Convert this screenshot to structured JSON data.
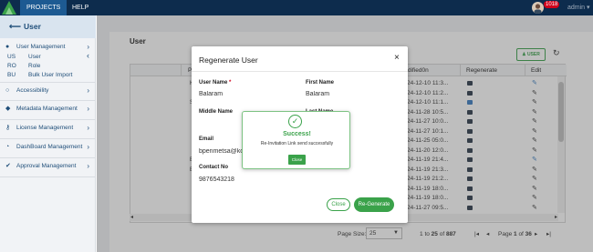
{
  "topbar": {
    "nav": [
      "PROJECTS",
      "HELP"
    ],
    "badge": "1018",
    "user": "admin",
    "caret": "▾"
  },
  "sidebar": {
    "header": "User",
    "user_management": "User Management",
    "sub_items": [
      {
        "code": "US",
        "label": "User"
      },
      {
        "code": "RO",
        "label": "Role"
      },
      {
        "code": "BU",
        "label": "Bulk User Import"
      }
    ],
    "sections": [
      "Accessibility",
      "Metadata Management",
      "License Management",
      "DashBoard Management",
      "Approval Management"
    ]
  },
  "page": {
    "title": "User",
    "add_user_button": "USER",
    "refresh_icon": "↻"
  },
  "grid": {
    "headers": {
      "p": "P",
      "modified": "dified0n",
      "regenerate": "Regenerate",
      "edit": "Edit"
    },
    "left_letters": [
      "K",
      "",
      "S",
      "",
      "",
      "",
      "",
      "",
      "E",
      "E",
      "",
      "",
      "",
      ""
    ],
    "modified_on": [
      "24-12-10 11:3...",
      "24-12-10 11:2...",
      "24-12-10 11:1...",
      "24-11-28 10:5...",
      "24-11-27 10:0...",
      "24-11-27 10:1...",
      "24-11-25 05:0...",
      "24-11-20 12:0...",
      "24-11-19 21:4...",
      "24-11-19 21:3...",
      "24-11-19 21:2...",
      "24-11-19 18:0...",
      "24-11-19 18:0...",
      "24-11-27 09:5..."
    ],
    "blue_regen_rows": [
      2
    ],
    "blue_edit_rows": [
      0,
      8
    ]
  },
  "pager": {
    "page_size_label": "Page Size:",
    "page_size": "25",
    "range_from": "1",
    "to_word": "to",
    "range_to": "25",
    "of_word": "of",
    "total": "887",
    "page_word": "Page",
    "current_page": "1",
    "total_pages": "36"
  },
  "modal": {
    "title": "Regenerate User",
    "close_x": "×",
    "user_name_label": "User Name",
    "user_name": "Balaram",
    "first_name_label": "First Name",
    "first_name": "Balaram",
    "middle_name_label": "Middle Name",
    "last_name_label": "Last Name",
    "email_label": "Email",
    "email": "bpenmetsa@ko",
    "contact_label": "Contact No",
    "contact": "9876543218",
    "close_button": "Close",
    "regenerate_button": "Re-Generate"
  },
  "toast": {
    "title": "Success!",
    "message": "Re-Invitation Link send successfully",
    "button": "Close"
  },
  "colors": {
    "topbar": "#0d2c4d",
    "accent_green": "#3aa24a",
    "nav_blue": "#1f4e79",
    "badge_red": "#d0021b"
  }
}
